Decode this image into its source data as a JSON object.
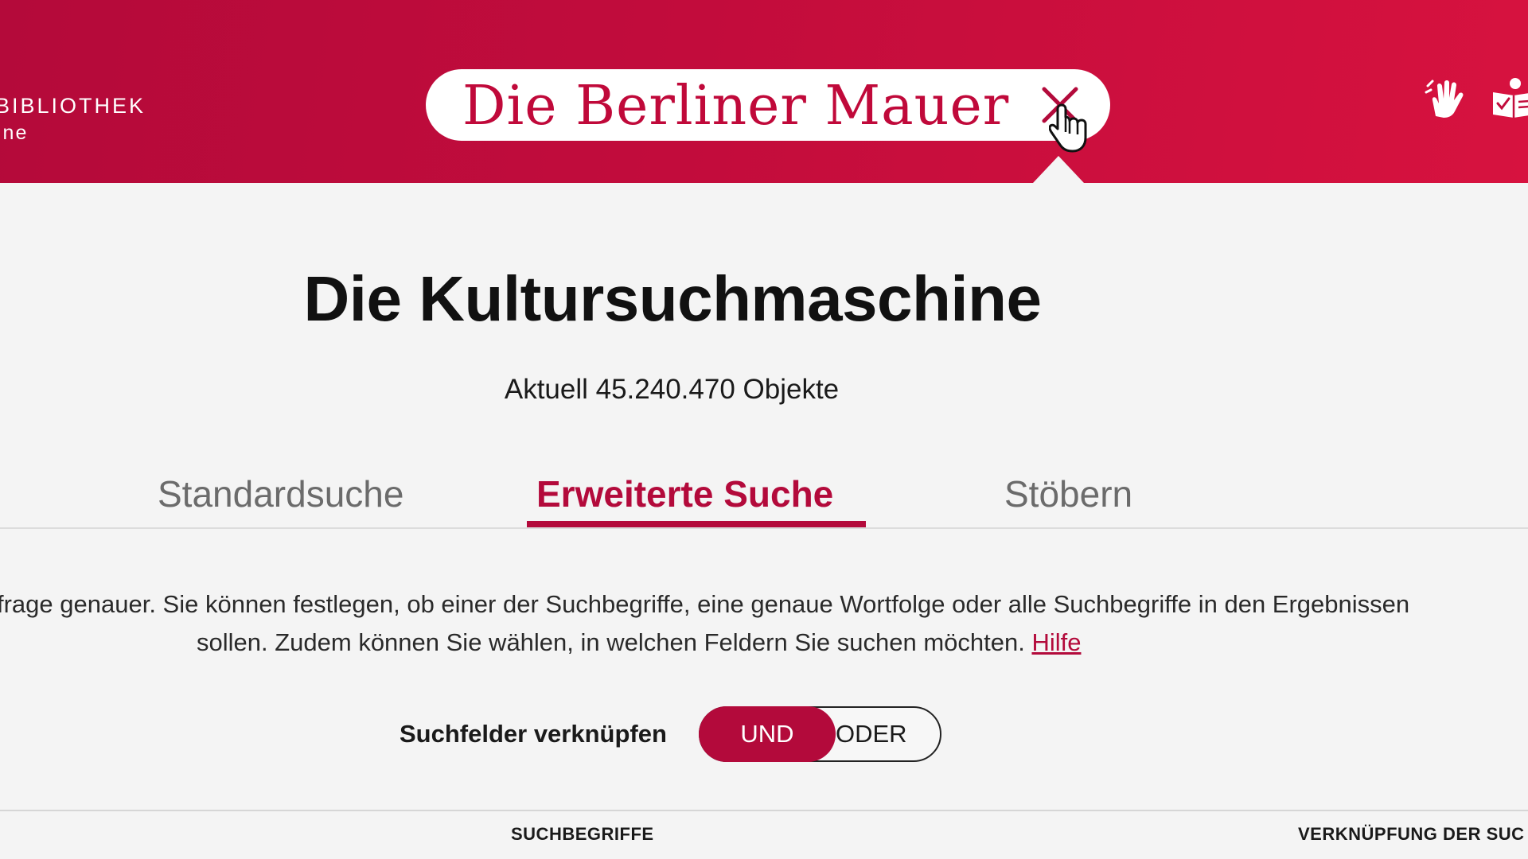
{
  "header": {
    "brand_line1": "BIBLIOTHEK",
    "brand_line2": "ine",
    "search_value": "Die Berliner Mauer",
    "clear_icon": "close-icon",
    "sign_language_icon": "sign-language-hand-icon",
    "easy_language_icon": "easy-language-book-icon"
  },
  "main": {
    "title": "Die Kultursuchmaschine",
    "object_count": "Aktuell 45.240.470 Objekte",
    "tabs": [
      {
        "label": "Standardsuche",
        "active": false
      },
      {
        "label": "Erweiterte Suche",
        "active": true
      },
      {
        "label": "Stöbern",
        "active": false
      }
    ],
    "intro_line1": "frage genauer. Sie können festlegen, ob einer der Suchbegriffe, eine genaue Wortfolge oder alle Suchbegriffe in den Ergebnissen",
    "intro_line2": "sollen. Zudem können Sie wählen, in welchen Feldern Sie suchen möchten.",
    "help_link": "Hilfe",
    "combine_label": "Suchfelder verknüpfen",
    "toggle": {
      "option_and": "UND",
      "option_or": "ODER",
      "selected": "UND"
    },
    "table_headers": {
      "search_terms": "SUCHBEGRIFFE",
      "combination": "VERKNÜPFUNG DER SUC"
    }
  },
  "colors": {
    "brand_red": "#c20c3c",
    "accent": "#b30a3b",
    "background": "#f4f4f4"
  }
}
